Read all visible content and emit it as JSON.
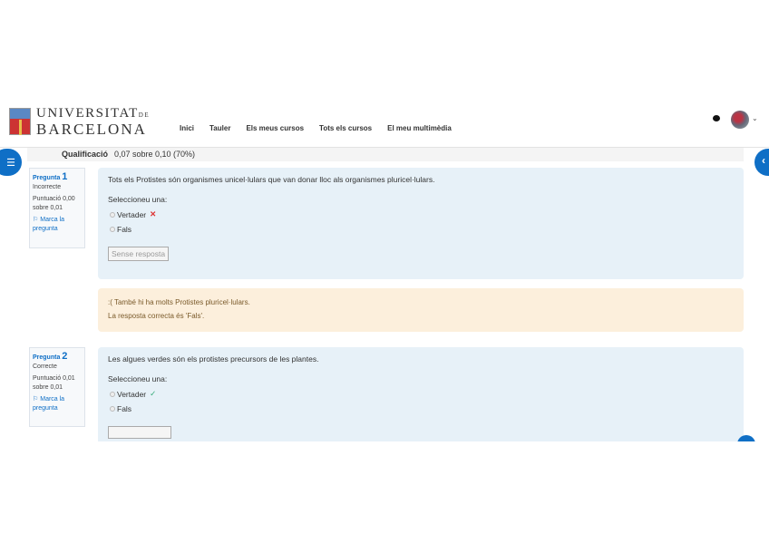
{
  "header": {
    "logo_line1": "UNIVERSITAT",
    "logo_de": "DE",
    "logo_line2": "BARCELONA",
    "nav": [
      "Inici",
      "Tauler",
      "Els meus cursos",
      "Tots els cursos",
      "El meu multimèdia"
    ]
  },
  "summary": {
    "label": "Qualificació",
    "value": "0,07 sobre 0,10 (70%)"
  },
  "questions": [
    {
      "label": "Pregunta",
      "num": "1",
      "state": "Incorrecte",
      "score": "Puntuació 0,00 sobre 0,01",
      "flag": "Marca la pregunta",
      "text": "Tots els Protistes són organismes unicel·lulars que van donar lloc als organismes pluricel·lulars.",
      "prompt": "Seleccioneu una:",
      "options": [
        "Vertader",
        "Fals"
      ],
      "button": "Sense resposta",
      "feedback": ":( També hi ha molts Protistes pluricel·lulars.",
      "correct": "La resposta correcta és 'Fals'."
    },
    {
      "label": "Pregunta",
      "num": "2",
      "state": "Correcte",
      "score": "Puntuació 0,01 sobre 0,01",
      "flag": "Marca la pregunta",
      "text": "Les algues verdes són els protistes precursors de les plantes.",
      "prompt": "Seleccioneu una:",
      "options": [
        "Vertader",
        "Fals"
      ]
    }
  ]
}
